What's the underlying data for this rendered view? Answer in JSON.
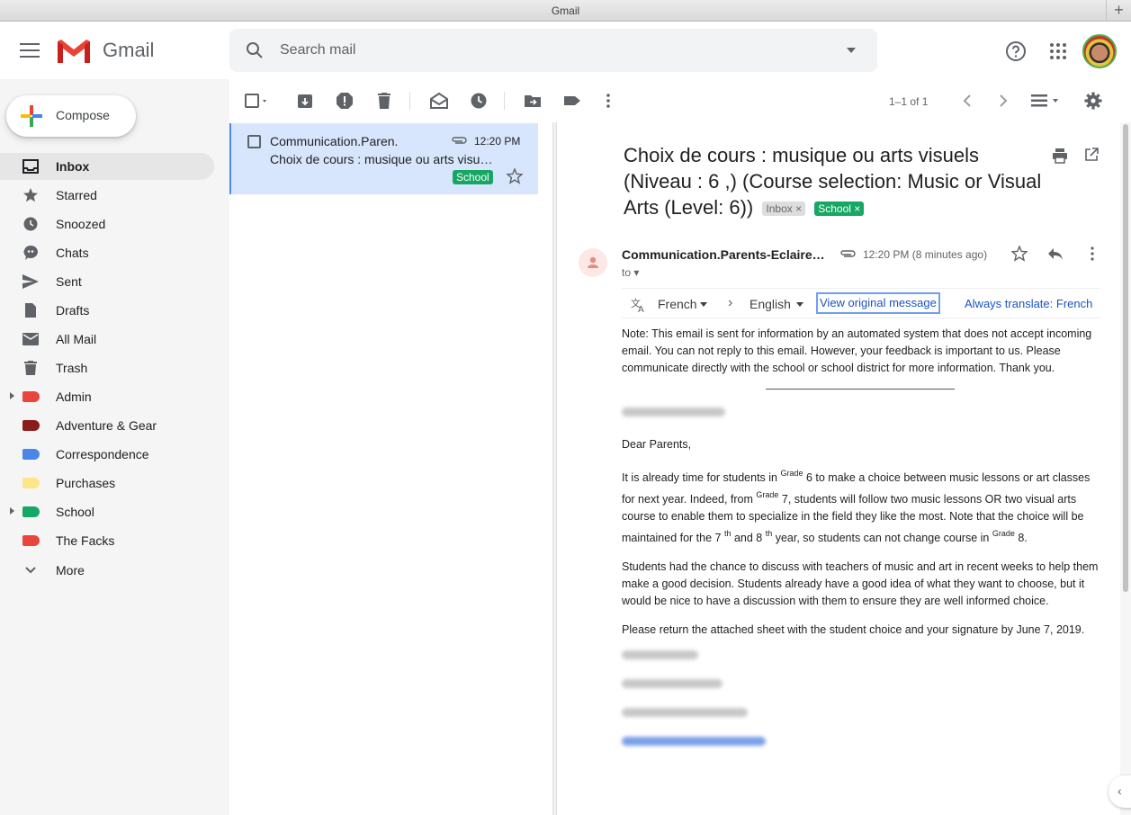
{
  "window": {
    "title": "Gmail",
    "new_tab": "+"
  },
  "header": {
    "brand": "Gmail",
    "search_placeholder": "Search mail"
  },
  "compose": {
    "label": "Compose"
  },
  "sidebar": {
    "items": [
      {
        "label": "Inbox",
        "icon": "inbox-icon",
        "active": true
      },
      {
        "label": "Starred",
        "icon": "star-icon"
      },
      {
        "label": "Snoozed",
        "icon": "clock-icon"
      },
      {
        "label": "Chats",
        "icon": "chat-icon"
      },
      {
        "label": "Sent",
        "icon": "send-icon"
      },
      {
        "label": "Drafts",
        "icon": "draft-icon"
      },
      {
        "label": "All Mail",
        "icon": "mail-icon"
      },
      {
        "label": "Trash",
        "icon": "trash-icon"
      },
      {
        "label": "Admin",
        "color": "#e8453c",
        "expandable": true
      },
      {
        "label": "Adventure & Gear",
        "color": "#8a1c1c"
      },
      {
        "label": "Correspondence",
        "color": "#4a86e8"
      },
      {
        "label": "Purchases",
        "color": "#fde58a"
      },
      {
        "label": "School",
        "color": "#16a765",
        "expandable": true
      },
      {
        "label": "The Facks",
        "color": "#e8453c"
      }
    ],
    "more_label": "More"
  },
  "toolbar": {
    "pager": "1–1 of 1"
  },
  "thread": {
    "sender": "Communication.Paren.",
    "time": "12:20 PM",
    "subject": "Choix de cours : musique ou arts visuels (Niveau : 6 ,) (Course selection: Music or Visual Arts (Level: 6))",
    "label": "School"
  },
  "message": {
    "subject": "Choix de cours : musique ou arts visuels (Niveau : 6 ,) (Course selection: Music or Visual Arts (Level: 6))",
    "chips": {
      "inbox": "Inbox ×",
      "school": "School ×"
    },
    "from": "Communication.Parents-Eclaireur…",
    "to": "to",
    "time": "12:20 PM (8 minutes ago)",
    "translate": {
      "from_lang": "French",
      "to_lang": "English",
      "view_original": "View original message",
      "always": "Always translate: French"
    },
    "note": "Note: This email is sent for information by an automated system that does not accept incoming email. You can not reply to this email. However, your feedback is important to us. Please communicate directly with the school or school district for more information. Thank you.",
    "greeting": "Dear Parents,",
    "para1": {
      "a": "It is already time for students in ",
      "grade": "Grade",
      "b": " 6 to make a choice between music lessons or art classes for next year. Indeed, from ",
      "c": " 7, students will follow two music lessons OR two visual arts course to enable them to specialize in the field they like the most. Note that the choice will be maintained for the 7 ",
      "th": "th",
      "d": " and 8 ",
      "e": " year, so students can not change course in ",
      "f": " 8."
    },
    "para2": "Students had the chance to discuss with teachers of music and art in recent weeks to help them make a good decision. Students already have a good idea of what they want to choose, but it would be nice to have a discussion with them to ensure they are well informed choice.",
    "para3": "Please return the attached sheet with the student choice and your signature by June 7, 2019."
  }
}
